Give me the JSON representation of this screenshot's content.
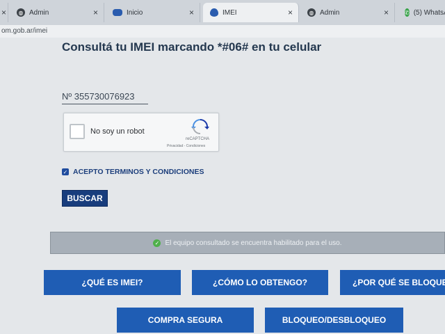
{
  "tabs": [
    {
      "label": "Admin",
      "icon": "globe-icon",
      "close": "×"
    },
    {
      "label": "Inicio",
      "icon": "site-logo-icon",
      "close": "×"
    },
    {
      "label": "IMEI",
      "icon": "argentina-logo-icon",
      "close": "×"
    },
    {
      "label": "Admin",
      "icon": "globe-icon",
      "close": "×"
    },
    {
      "label": "(5) WhatsA",
      "icon": "whatsapp-icon",
      "close": ""
    }
  ],
  "address": {
    "url": "om.gob.ar/imei"
  },
  "main": {
    "heading": "Consultá tu IMEI marcando *#06# en tu celular",
    "imei_value": "Nº  355730076923",
    "captcha": {
      "label": "No soy un robot",
      "brand": "reCAPTCHA",
      "links": "Privacidad - Condiciones"
    },
    "terms_label": "ACEPTO TERMINOS Y CONDICIONES",
    "search_button": "BUSCAR",
    "alert_message": "El equipo consultado se encuentra habilitado para el uso.",
    "nav_buttons": [
      {
        "label": "¿QUÉ ES IMEI?"
      },
      {
        "label": "¿CÓMO LO OBTENGO?"
      },
      {
        "label": "¿POR QUÉ SE BLOQUEA?"
      },
      {
        "label": "COMPRA SEGURA"
      },
      {
        "label": "BLOQUEO/DESBLOQUEO"
      }
    ]
  },
  "colors": {
    "primary_button": "#183d7d",
    "nav_button": "#1f5db4",
    "heading": "#24384f",
    "success": "#4fb04a"
  }
}
